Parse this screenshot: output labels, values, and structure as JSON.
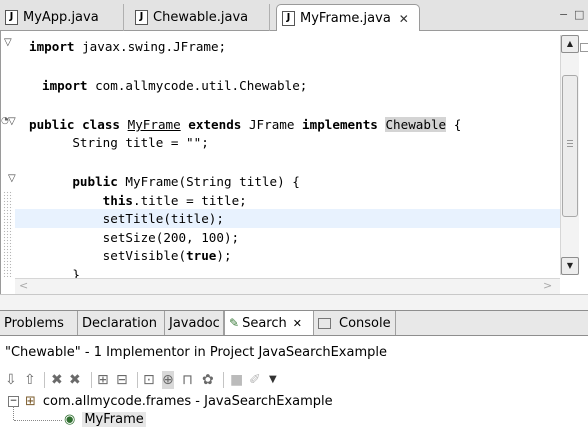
{
  "editor_tabs": [
    {
      "label": "MyApp.java",
      "icon": "java-file-icon",
      "active": false
    },
    {
      "label": "Chewable.java",
      "icon": "java-file-icon",
      "active": false
    },
    {
      "label": "MyFrame.java",
      "icon": "java-file-icon",
      "active": true,
      "close": "✕"
    }
  ],
  "window_controls": {
    "minimize": "−",
    "maximize": "□"
  },
  "code": {
    "l1_kw": "import",
    "l1_rest": " javax.swing.JFrame;",
    "l2_kw": "import",
    "l2_rest": " com.allmycode.util.Chewable;",
    "l3_kw1": "public",
    "l3_kw2": "class",
    "l3_name": "MyFrame",
    "l3_kw3": "extends",
    "l3_mid": " JFrame ",
    "l3_kw4": "implements",
    "l3_iface": "Chewable",
    "l3_end": " {",
    "l4": "    String title = \"\";",
    "l5_kw": "public",
    "l5_rest": " MyFrame(String title) {",
    "l6_kw": "this",
    "l6_rest": ".title = title;",
    "l7": "        setTitle(title);",
    "l8": "        setSize(200, 100);",
    "l9_a": "        setVisible(",
    "l9_kw": "true",
    "l9_b": ");",
    "l10": "    }"
  },
  "view_tabs": [
    {
      "label": "Problems"
    },
    {
      "label": "Declaration"
    },
    {
      "label": "Javadoc"
    },
    {
      "label": "Search",
      "active": true,
      "close": "✕"
    },
    {
      "label": "Console"
    }
  ],
  "search": {
    "summary": "\"Chewable\" - 1 Implementor in Project JavaSearchExample",
    "tree": {
      "package": "com.allmycode.frames - JavaSearchExample",
      "class": "MyFrame"
    }
  },
  "toolbar_icons": [
    "next-match-icon",
    "previous-match-icon",
    "remove-match-icon",
    "remove-all-matches-icon",
    "expand-all-icon",
    "collapse-all-icon",
    "go-to-file-icon",
    "show-as-tree-icon",
    "show-as-list-icon",
    "search-history-icon",
    "pin-view-icon",
    "view-menu-icon"
  ],
  "colors": {
    "current_line": "#e8f2fe",
    "occurrence_highlight": "#d4d4d4",
    "tab_bar": "#e3e3e3"
  }
}
